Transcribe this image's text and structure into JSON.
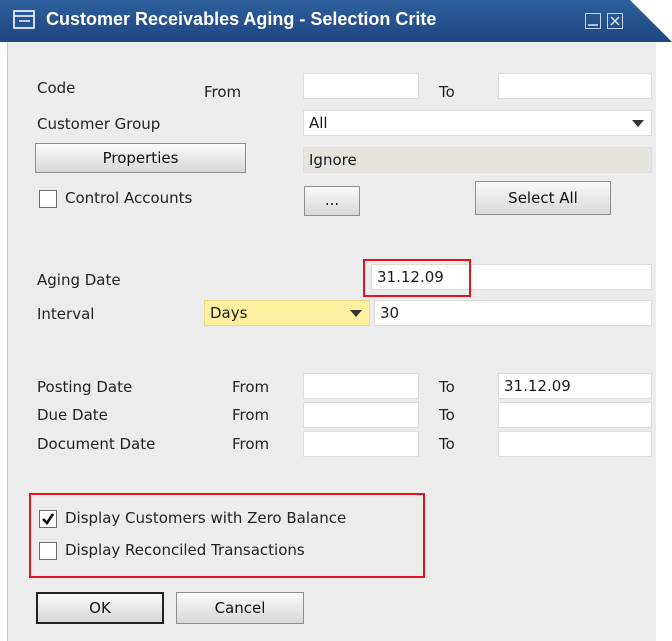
{
  "window": {
    "title": "Customer Receivables Aging - Selection Crite"
  },
  "code": {
    "label": "Code",
    "from_label": "From",
    "from_value": "",
    "to_label": "To",
    "to_value": ""
  },
  "customer_group": {
    "label": "Customer Group",
    "value": "All"
  },
  "properties": {
    "button_label": "Properties",
    "value": "Ignore"
  },
  "control_accounts": {
    "label": "Control Accounts",
    "checked": false,
    "browse_label": "...",
    "select_all_label": "Select All"
  },
  "aging_date": {
    "label": "Aging Date",
    "value": "31.12.09"
  },
  "interval": {
    "label": "Interval",
    "unit": "Days",
    "value": "30"
  },
  "posting_date": {
    "label": "Posting Date",
    "from_label": "From",
    "from_value": "",
    "to_label": "To",
    "to_value": "31.12.09"
  },
  "due_date": {
    "label": "Due Date",
    "from_label": "From",
    "from_value": "",
    "to_label": "To",
    "to_value": ""
  },
  "document_date": {
    "label": "Document Date",
    "from_label": "From",
    "from_value": "",
    "to_label": "To",
    "to_value": ""
  },
  "options": {
    "zero_balance": {
      "label": "Display Customers with Zero Balance",
      "checked": true
    },
    "reconciled": {
      "label": "Display Reconciled Transactions",
      "checked": false
    }
  },
  "actions": {
    "ok_label": "OK",
    "cancel_label": "Cancel"
  },
  "colors": {
    "titlebar": "#2a5896",
    "dropdown_yellow": "#fff0a0",
    "highlight": "#e0141e"
  }
}
